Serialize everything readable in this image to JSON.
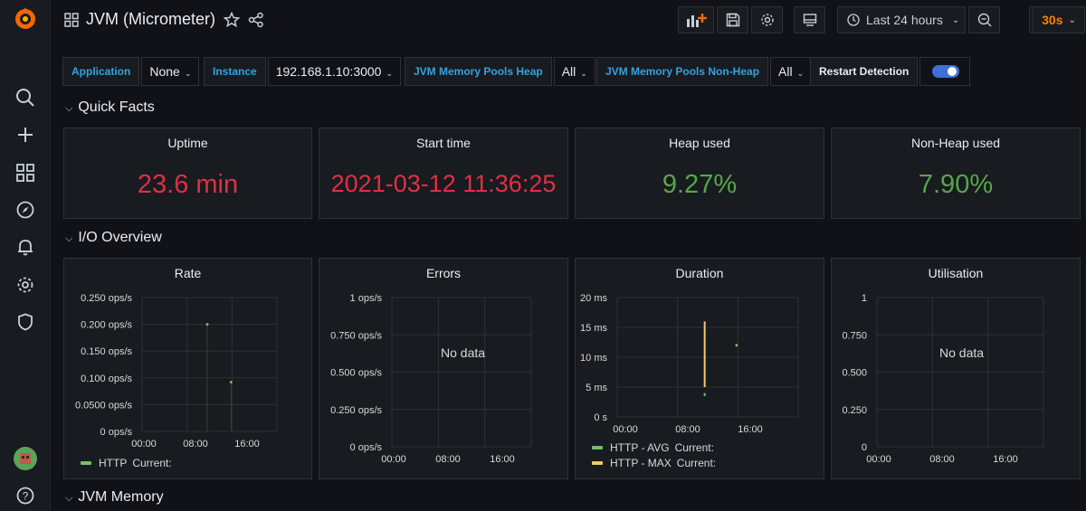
{
  "header": {
    "title": "JVM (Micrometer)",
    "time_range": "Last 24 hours",
    "refresh": "30s"
  },
  "variables": [
    {
      "label": "Application",
      "value": "None"
    },
    {
      "label": "Instance",
      "value": "192.168.1.10:3000"
    },
    {
      "label": "JVM Memory Pools Heap",
      "value": "All"
    },
    {
      "label": "JVM Memory Pools Non-Heap",
      "value": "All"
    }
  ],
  "restart_detection": {
    "label": "Restart Detection",
    "enabled": true
  },
  "rows": {
    "quick_facts": "Quick Facts",
    "io_overview": "I/O Overview",
    "jvm_memory": "JVM Memory"
  },
  "stats": [
    {
      "title": "Uptime",
      "value": "23.6 min",
      "color": "#e02f44"
    },
    {
      "title": "Start time",
      "value": "2021-03-12 11:36:25",
      "color": "#e02f44"
    },
    {
      "title": "Heap used",
      "value": "9.27%",
      "color": "#56a64b"
    },
    {
      "title": "Non-Heap used",
      "value": "7.90%",
      "color": "#56a64b"
    }
  ],
  "chart_data": [
    {
      "type": "scatter",
      "title": "Rate",
      "y_ticks": [
        "0.250 ops/s",
        "0.200 ops/s",
        "0.150 ops/s",
        "0.100 ops/s",
        "0.0500 ops/s",
        "0 ops/s"
      ],
      "x_ticks": [
        "00:00",
        "08:00",
        "16:00"
      ],
      "series": [
        {
          "name": "HTTP",
          "color": "#73bf69",
          "x": [
            "11:36",
            "15:50"
          ],
          "values": [
            0.2,
            0.092
          ]
        }
      ],
      "legend": [
        {
          "label": "HTTP",
          "current": "Current:",
          "color": "#73bf69"
        }
      ],
      "ylim": [
        0,
        0.25
      ]
    },
    {
      "type": "line",
      "title": "Errors",
      "y_ticks": [
        "1 ops/s",
        "0.750 ops/s",
        "0.500 ops/s",
        "0.250 ops/s",
        "0 ops/s"
      ],
      "x_ticks": [
        "00:00",
        "08:00",
        "16:00"
      ],
      "no_data": "No data",
      "series": []
    },
    {
      "type": "line",
      "title": "Duration",
      "y_ticks": [
        "20 ms",
        "15 ms",
        "10 ms",
        "5 ms",
        "0 s"
      ],
      "x_ticks": [
        "00:00",
        "08:00",
        "16:00"
      ],
      "series": [
        {
          "name": "HTTP - AVG",
          "color": "#73bf69",
          "x": [
            "11:36",
            "11:36",
            "15:50"
          ],
          "values": [
            4,
            3.5,
            12
          ]
        },
        {
          "name": "HTTP - MAX",
          "color": "#f2c96d",
          "x": [
            "11:36",
            "11:36",
            "11:36",
            "11:36"
          ],
          "values": [
            16,
            9,
            8,
            5
          ]
        }
      ],
      "legend": [
        {
          "label": "HTTP - AVG",
          "current": "Current:",
          "color": "#73bf69"
        },
        {
          "label": "HTTP - MAX",
          "current": "Current:",
          "color": "#f2c96d"
        }
      ],
      "ylim": [
        0,
        20
      ]
    },
    {
      "type": "line",
      "title": "Utilisation",
      "y_ticks": [
        "1",
        "0.750",
        "0.500",
        "0.250",
        "0"
      ],
      "x_ticks": [
        "00:00",
        "08:00",
        "16:00"
      ],
      "no_data": "No data",
      "series": []
    }
  ],
  "colors": {
    "accent": "#33a2e5",
    "refresh": "#ff7f00",
    "logo": "#f46800"
  }
}
